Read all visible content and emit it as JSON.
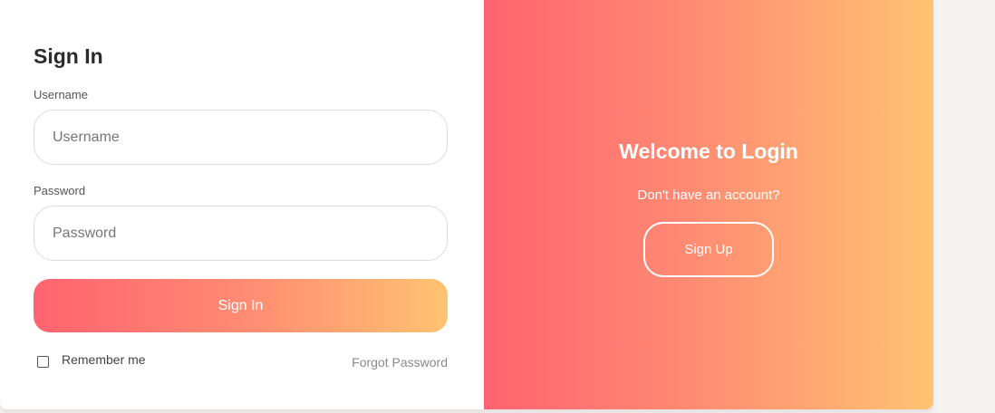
{
  "login_form": {
    "title": "Sign In",
    "username": {
      "label": "Username",
      "placeholder": "Username",
      "value": ""
    },
    "password": {
      "label": "Password",
      "placeholder": "Password",
      "value": ""
    },
    "submit_label": "Sign In",
    "remember_label": "Remember me",
    "remember_checked": false,
    "forgot_label": "Forgot Password"
  },
  "welcome_panel": {
    "title": "Welcome to Login",
    "subtitle": "Don't have an account?",
    "signup_label": "Sign Up"
  },
  "colors": {
    "gradient_start": "#ff6370",
    "gradient_end": "#ffc372",
    "page_background": "#f7f3f3",
    "card_background": "#ffffff"
  }
}
